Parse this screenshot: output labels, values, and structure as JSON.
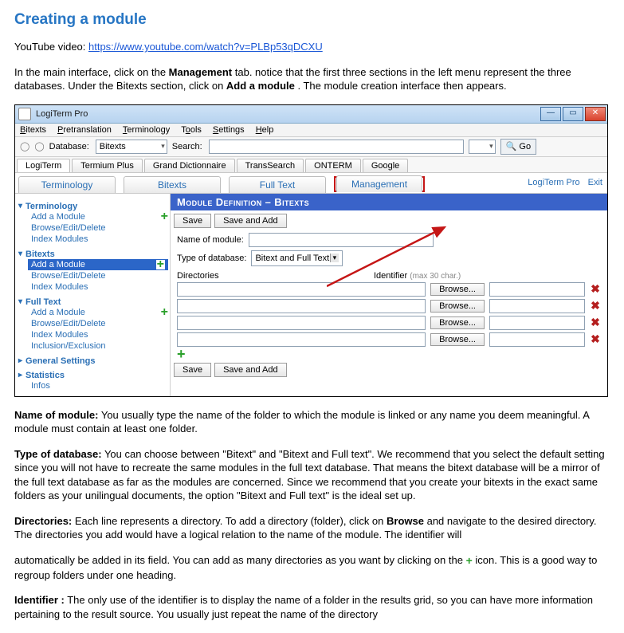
{
  "page": {
    "title": "Creating a module",
    "yt_prefix": "YouTube video: ",
    "yt_url": "https://www.youtube.com/watch?v=PLBp53qDCXU",
    "intro_1a": "In the main interface, click on the ",
    "intro_mgmt": "Management",
    "intro_1b": " tab. notice that the first three sections in the left menu represent the three databases. Under the Bitexts section, click on ",
    "intro_add": "Add a module",
    "intro_1c": ". The module creation interface then appears."
  },
  "shot": {
    "window_title": "LogiTerm Pro",
    "menu": [
      "Bitexts",
      "Pretranslation",
      "Terminology",
      "Tools",
      "Settings",
      "Help"
    ],
    "toolbar": {
      "database_lbl": "Database:",
      "database_val": "Bitexts",
      "search_lbl": "Search:",
      "go": "Go"
    },
    "subtabs": [
      "LogiTerm",
      "Termium Plus",
      "Grand Dictionnaire",
      "TransSearch",
      "ONTERM",
      "Google"
    ],
    "maintabs": [
      "Terminology",
      "Bitexts",
      "Full Text",
      "Management"
    ],
    "rightlinks": [
      "LogiTerm Pro",
      "Exit"
    ],
    "nav": {
      "terminology": {
        "title": "Terminology",
        "items": [
          "Add a Module",
          "Browse/Edit/Delete",
          "Index Modules"
        ]
      },
      "bitexts": {
        "title": "Bitexts",
        "items": [
          "Add a Module",
          "Browse/Edit/Delete",
          "Index Modules"
        ]
      },
      "fulltext": {
        "title": "Full Text",
        "items": [
          "Add a Module",
          "Browse/Edit/Delete",
          "Index Modules",
          "Inclusion/Exclusion"
        ]
      },
      "general": "General Settings",
      "statistics": "Statistics",
      "infos": "Infos"
    },
    "panel": {
      "section_title": "Module Definition – Bitexts",
      "save": "Save",
      "save_add": "Save and Add",
      "name_lbl": "Name of module:",
      "type_lbl": "Type of database:",
      "type_val": "Bitext and Full Text",
      "dir_lbl": "Directories",
      "ident_lbl": "Identifier",
      "ident_hint": "(max 30 char.)",
      "browse": "Browse...",
      "del": "✖",
      "plus": "+"
    }
  },
  "desc": {
    "name_t": "Name of module:",
    "name_b": " You usually type the name of the folder to which the module is linked or any name you deem meaningful. A module must contain at least one folder.",
    "type_t": "Type of database:",
    "type_b": " You can choose between \"Bitext\" and \"Bitext and Full text\". We recommend that you select the default setting since you will not have to recreate the same modules in the full text database. That means the bitext database will be a mirror of the full text database as far as the modules are concerned. Since we recommend that you create your bitexts in the exact same folders as your unilingual documents, the option \"Bitext and Full text\" is the ideal set up.",
    "dir_t": "Directories:",
    "dir_b1": " Each line represents a directory. To add a directory (folder), click on ",
    "dir_browse": "Browse",
    "dir_b2": " and navigate to the desired directory. The directories you add would have a logical relation to the name of the module. The identifier will",
    "dir_c1": "automatically be added in its field. You can add as many directories as you want by clicking on the ",
    "dir_c2": " icon. This is a good way to regroup folders under one heading.",
    "plus": "+",
    "ident_t": "Identifier :",
    "ident_b": " The only use of the identifier is to display the name of a folder in the results grid, so you can have more information pertaining to the result source. You usually just repeat the name of the directory"
  }
}
